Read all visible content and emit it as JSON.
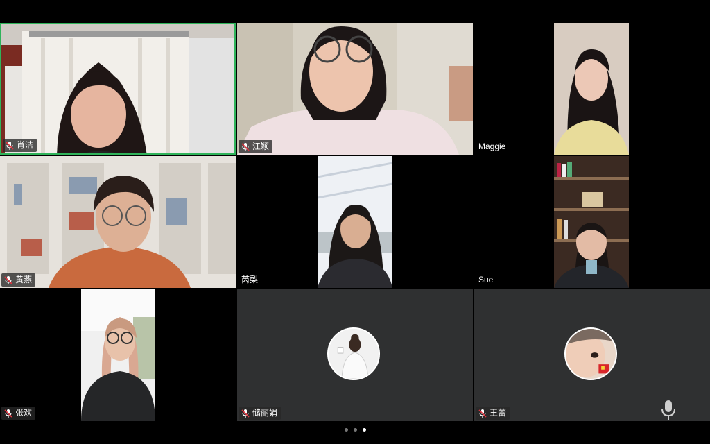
{
  "participants": [
    {
      "name": "肖洁",
      "muted": true,
      "speaking": true
    },
    {
      "name": "江颖",
      "muted": true
    },
    {
      "name": "Maggie",
      "muted": false
    },
    {
      "name": "黄燕",
      "muted": true
    },
    {
      "name": "芮梨",
      "muted": false
    },
    {
      "name": "Sue",
      "muted": false
    },
    {
      "name": "张欢",
      "muted": true
    },
    {
      "name": "储丽娟",
      "muted": true,
      "video": false,
      "avatar": "woman-illustration-avatar"
    },
    {
      "name": "王蕾",
      "muted": true,
      "video": false,
      "avatar": "child-photo-avatar"
    }
  ],
  "pagination": {
    "pages": 3,
    "current": 3
  },
  "toolbar": {
    "mic_icon": "microphone-icon"
  },
  "colors": {
    "speaking_border": "#2fb35a",
    "muted_mic": "#e2333f",
    "tile_off": "#2f3031"
  }
}
